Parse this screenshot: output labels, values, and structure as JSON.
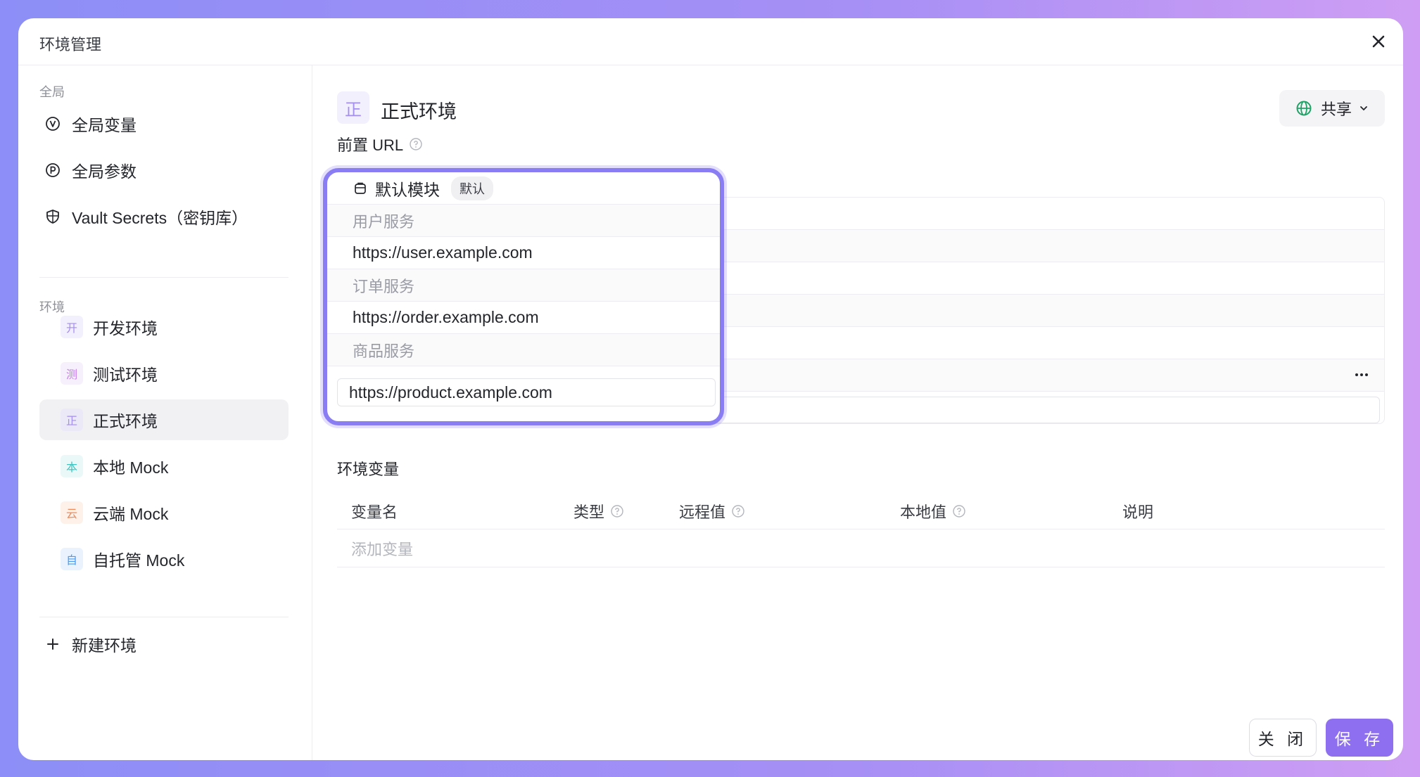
{
  "modal": {
    "title": "环境管理"
  },
  "sidebar": {
    "global_label": "全局",
    "global_items": [
      {
        "icon": "v-circle-icon",
        "label": "全局变量"
      },
      {
        "icon": "p-circle-icon",
        "label": "全局参数"
      },
      {
        "icon": "shield-icon",
        "label": "Vault Secrets（密钥库）"
      }
    ],
    "env_label": "环境",
    "env_items": [
      {
        "badge": "开",
        "label": "开发环境",
        "color": "#a48ef0",
        "bg": "#f3f0fe"
      },
      {
        "badge": "测",
        "label": "测试环境",
        "color": "#c47ee8",
        "bg": "#f6effc"
      },
      {
        "badge": "正",
        "label": "正式环境",
        "color": "#a48ef0",
        "bg": "#ebe9f8",
        "active": true
      },
      {
        "badge": "本",
        "label": "本地 Mock",
        "color": "#3fc3c0",
        "bg": "#eaf8f8"
      },
      {
        "badge": "云",
        "label": "云端 Mock",
        "color": "#f08a5a",
        "bg": "#fdf1ea"
      },
      {
        "badge": "自",
        "label": "自托管 Mock",
        "color": "#4a9cf0",
        "bg": "#eaf3fd"
      }
    ],
    "new_env_label": "新建环境"
  },
  "main": {
    "env_badge": "正",
    "env_title": "正式环境",
    "share_label": "共享",
    "prefix_url_label": "前置 URL",
    "url_list": {
      "module_name": "默认模块",
      "module_tag": "默认",
      "rows": [
        {
          "type": "group",
          "text": "用户服务"
        },
        {
          "type": "url",
          "text": "https://user.example.com"
        },
        {
          "type": "group",
          "text": "订单服务"
        },
        {
          "type": "url",
          "text": "https://order.example.com"
        },
        {
          "type": "group",
          "text": "商品服务"
        }
      ],
      "last_url": "https://product.example.com"
    },
    "env_vars_label": "环境变量",
    "columns": [
      "变量名",
      "类型",
      "远程值",
      "本地值",
      "说明"
    ],
    "add_variable": "添加变量"
  },
  "footer": {
    "close_label": "关 闭",
    "save_label": "保 存"
  },
  "colors": {
    "accent": "#8d6ff0",
    "highlight": "#8a7df3"
  }
}
